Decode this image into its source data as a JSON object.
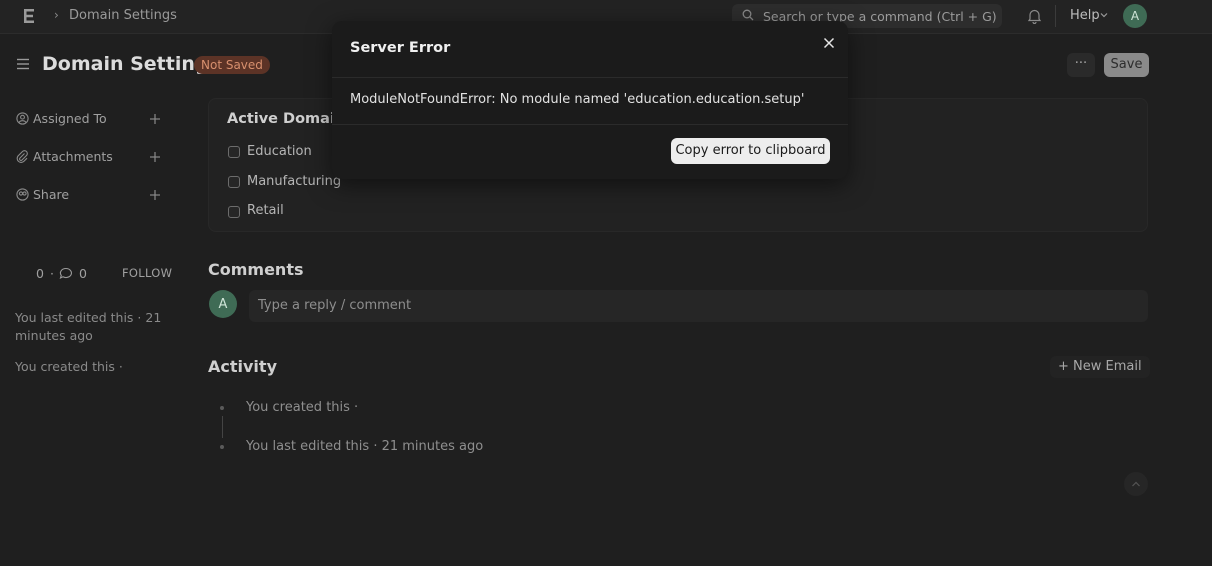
{
  "navbar": {
    "breadcrumb": "Domain Settings",
    "search_placeholder": "Search or type a command (Ctrl + G)",
    "help_label": "Help",
    "avatar_initial": "A"
  },
  "header": {
    "title": "Domain Settings",
    "status_badge": "Not Saved",
    "more_label": "···",
    "save_label": "Save"
  },
  "sidebar": {
    "items": [
      {
        "label": "Assigned To",
        "icon": "assign-icon"
      },
      {
        "label": "Attachments",
        "icon": "paperclip-icon"
      },
      {
        "label": "Share",
        "icon": "share-icon"
      }
    ],
    "likes_count": "0",
    "comments_count": "0",
    "follow_label": "FOLLOW",
    "last_edited": "You last edited this · 21 minutes ago",
    "created": "You created this ·"
  },
  "form": {
    "section_title": "Active Domains",
    "domains": [
      "Education",
      "Manufacturing",
      "Retail"
    ]
  },
  "comments": {
    "title": "Comments",
    "avatar_initial": "A",
    "placeholder": "Type a reply / comment"
  },
  "activity": {
    "title": "Activity",
    "new_email_label": "+ New Email",
    "items": [
      "You created this ·",
      "You last edited this · 21 minutes ago"
    ]
  },
  "modal": {
    "title": "Server Error",
    "message": "ModuleNotFoundError: No module named 'education.education.setup'",
    "copy_label": "Copy error to clipboard"
  },
  "colors": {
    "background": "#1f1f1f",
    "badge_text": "#d8906e",
    "avatar_bg": "#3f6b55"
  }
}
